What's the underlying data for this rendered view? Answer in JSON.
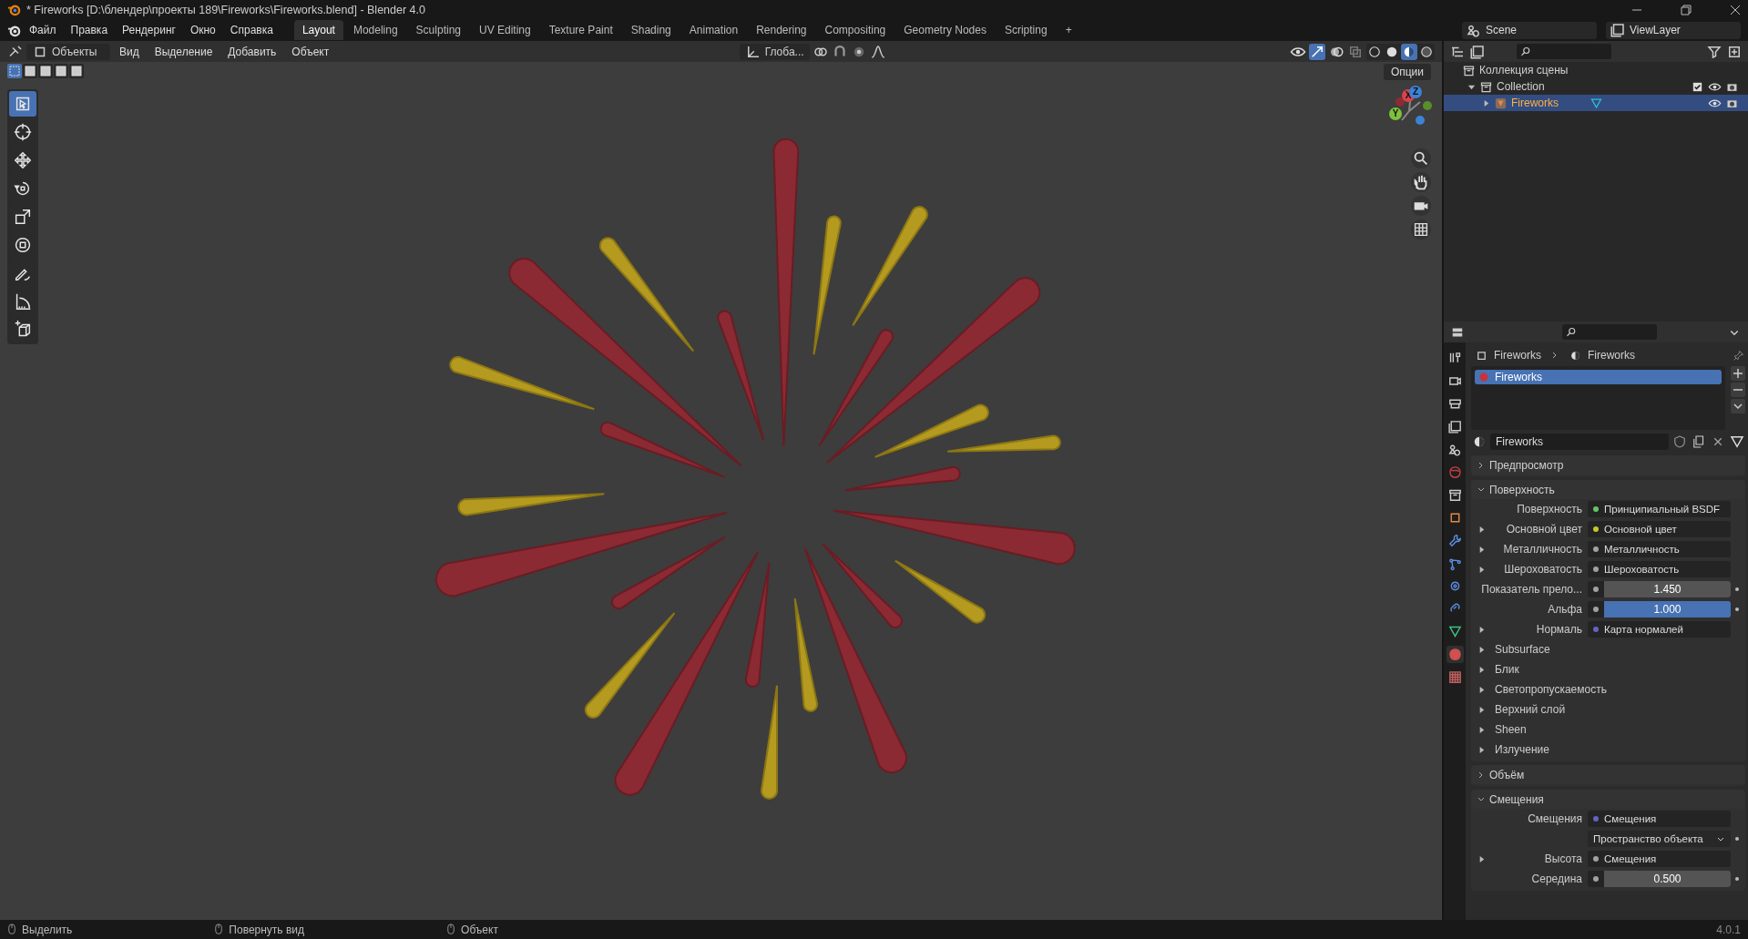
{
  "window": {
    "title": "* Fireworks [D:\\блендер\\проекты 189\\Fireworks\\Fireworks.blend] - Blender 4.0"
  },
  "menu": [
    "Файл",
    "Правка",
    "Рендеринг",
    "Окно",
    "Справка"
  ],
  "workspaces": [
    {
      "label": "Layout",
      "selected": true
    },
    {
      "label": "Modeling",
      "selected": false
    },
    {
      "label": "Sculpting",
      "selected": false
    },
    {
      "label": "UV Editing",
      "selected": false
    },
    {
      "label": "Texture Paint",
      "selected": false
    },
    {
      "label": "Shading",
      "selected": false
    },
    {
      "label": "Animation",
      "selected": false
    },
    {
      "label": "Rendering",
      "selected": false
    },
    {
      "label": "Compositing",
      "selected": false
    },
    {
      "label": "Geometry Nodes",
      "selected": false
    },
    {
      "label": "Scripting",
      "selected": false
    }
  ],
  "add_workspace": "+",
  "scene": "Scene",
  "view_layer": "ViewLayer",
  "viewport_header": {
    "mode": "Объекты",
    "menus": [
      "Вид",
      "Выделение",
      "Добавить",
      "Объект"
    ],
    "orientation": "Глоба..."
  },
  "select_modes": [
    {
      "selected": true
    },
    {
      "selected": false
    },
    {
      "selected": false
    },
    {
      "selected": false
    },
    {
      "selected": false
    }
  ],
  "shading_modes": [
    {
      "kind": "wireframe",
      "selected": false
    },
    {
      "kind": "solid",
      "selected": false
    },
    {
      "kind": "material",
      "selected": true
    },
    {
      "kind": "rendered",
      "selected": false
    }
  ],
  "options_button": "Опции",
  "tools": [
    {
      "kind": "select",
      "selected": true
    },
    {
      "kind": "cursor",
      "selected": false
    },
    {
      "kind": "move",
      "selected": false
    },
    {
      "kind": "rotate",
      "selected": false
    },
    {
      "kind": "scale",
      "selected": false
    },
    {
      "kind": "transform",
      "selected": false
    },
    {
      "kind": "annotate",
      "selected": false
    },
    {
      "kind": "measure",
      "selected": false
    },
    {
      "kind": "add_cube",
      "selected": false
    }
  ],
  "gizmo": {
    "axes": [
      "X",
      "Y",
      "Z"
    ]
  },
  "outliner": {
    "root": "Коллекция сцены",
    "collections": [
      {
        "label": "Collection",
        "expanded": true,
        "checked": true,
        "objects": [
          {
            "label": "Fireworks",
            "expanded": false,
            "selected": true
          }
        ]
      }
    ]
  },
  "properties": {
    "tabs": [
      {
        "kind": "tool",
        "selected": false
      },
      {
        "kind": "render",
        "selected": false
      },
      {
        "kind": "output",
        "selected": false
      },
      {
        "kind": "view_layer",
        "selected": false
      },
      {
        "kind": "scene",
        "selected": false
      },
      {
        "kind": "world",
        "selected": false
      },
      {
        "kind": "collection",
        "selected": false
      },
      {
        "kind": "object",
        "selected": false
      },
      {
        "kind": "modifier",
        "selected": false
      },
      {
        "kind": "particles",
        "selected": false
      },
      {
        "kind": "physics",
        "selected": false
      },
      {
        "kind": "constraints",
        "selected": false
      },
      {
        "kind": "data",
        "selected": false
      },
      {
        "kind": "material",
        "selected": true
      },
      {
        "kind": "texture",
        "selected": false
      }
    ],
    "breadcrumb": [
      "Fireworks",
      "Fireworks"
    ],
    "slots": [
      {
        "label": "Fireworks",
        "selected": true
      }
    ],
    "material_name": "Fireworks",
    "panels": [
      {
        "title": "Предпросмотр",
        "expanded": false
      },
      {
        "title": "Поверхность",
        "expanded": true,
        "rows": [
          {
            "kind": "link",
            "label": "Поверхность",
            "value": "Принципиальный BSDF",
            "color": "#63c763",
            "expandable": false
          },
          {
            "kind": "link",
            "label": "Основной цвет",
            "value": "Основной цвет",
            "color": "#c7c729",
            "expandable": true
          },
          {
            "kind": "link",
            "label": "Металличность",
            "value": "Металличность",
            "color": "#a1a1a1",
            "expandable": true
          },
          {
            "kind": "link",
            "label": "Шероховатость",
            "value": "Шероховатость",
            "color": "#a1a1a1",
            "expandable": true
          },
          {
            "kind": "number",
            "label": "Показатель прело...",
            "value": "1.450",
            "color": "#a1a1a1"
          },
          {
            "kind": "slider",
            "label": "Альфа",
            "value": "1.000",
            "level": 1,
            "color": "#a1a1a1"
          },
          {
            "kind": "link",
            "label": "Нормаль",
            "value": "Карта нормалей",
            "color": "#6363c7",
            "expandable": true
          },
          {
            "kind": "subpanel",
            "label": "Subsurface"
          },
          {
            "kind": "subpanel",
            "label": "Блик"
          },
          {
            "kind": "subpanel",
            "label": "Светопропускаемость"
          },
          {
            "kind": "subpanel",
            "label": "Верхний слой"
          },
          {
            "kind": "subpanel",
            "label": "Sheen"
          },
          {
            "kind": "subpanel",
            "label": "Излучение"
          }
        ]
      },
      {
        "title": "Объём",
        "expanded": false
      },
      {
        "title": "Смещения",
        "expanded": true,
        "rows": [
          {
            "kind": "link",
            "label": "Смещения",
            "value": "Смещения",
            "color": "#6363c7",
            "expandable": false
          },
          {
            "kind": "dropdown",
            "value": "Пространство объекта"
          },
          {
            "kind": "link",
            "label": "Высота",
            "value": "Смещения",
            "color": "#a1a1a1",
            "expandable": true
          },
          {
            "kind": "number",
            "label": "Середина",
            "value": "0.500",
            "color": "#a1a1a1"
          }
        ]
      }
    ]
  },
  "status_bar": {
    "items": [
      "Выделить",
      "Повернуть вид",
      "Объект"
    ],
    "version": "4.0.1"
  }
}
